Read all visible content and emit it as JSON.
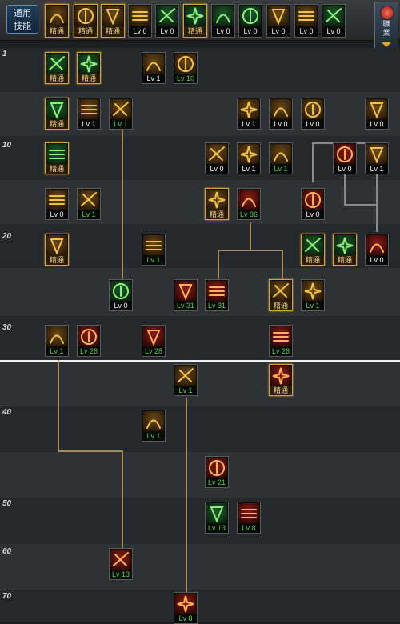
{
  "sidebar": {
    "common_skills_label": [
      "通用",
      "技能"
    ],
    "page_toggle_label": [
      "職",
      "業"
    ]
  },
  "top_skills": [
    {
      "badge": "精通",
      "theme": "gold"
    },
    {
      "badge": "精通",
      "theme": "gold"
    },
    {
      "badge": "精通",
      "theme": "gold"
    },
    {
      "badge": "Lv 0",
      "theme": "gold"
    },
    {
      "badge": "Lv 0",
      "theme": "green"
    },
    {
      "badge": "精通",
      "theme": "green"
    },
    {
      "badge": "Lv 0",
      "theme": "green"
    },
    {
      "badge": "Lv 0",
      "theme": "green"
    },
    {
      "badge": "Lv 0",
      "theme": "gold"
    },
    {
      "badge": "Lv 0",
      "theme": "gold"
    },
    {
      "badge": "Lv 0",
      "theme": "green"
    }
  ],
  "level_labels": [
    "1",
    "10",
    "20",
    "30",
    "40",
    "50",
    "60",
    "70"
  ],
  "skills": [
    {
      "badge": "精通",
      "kind": "master",
      "theme": "green"
    },
    {
      "badge": "精通",
      "kind": "master",
      "theme": "green"
    },
    {
      "badge": "Lv 1",
      "kind": "white",
      "theme": "gold"
    },
    {
      "badge": "Lv 10",
      "kind": "green",
      "theme": "gold"
    },
    {
      "badge": "精通",
      "kind": "master",
      "theme": "green"
    },
    {
      "badge": "Lv 1",
      "kind": "white",
      "theme": "gold"
    },
    {
      "badge": "Lv 1",
      "kind": "green",
      "theme": "gold"
    },
    {
      "badge": "Lv 1",
      "kind": "white",
      "theme": "gold"
    },
    {
      "badge": "Lv 0",
      "kind": "white",
      "theme": "gold"
    },
    {
      "badge": "Lv 0",
      "kind": "white",
      "theme": "gold"
    },
    {
      "badge": "Lv 0",
      "kind": "white",
      "theme": "gold"
    },
    {
      "badge": "精通",
      "kind": "master",
      "theme": "green"
    },
    {
      "badge": "Lv 0",
      "kind": "white",
      "theme": "gold"
    },
    {
      "badge": "Lv 1",
      "kind": "white",
      "theme": "gold"
    },
    {
      "badge": "Lv 1",
      "kind": "green",
      "theme": "gold"
    },
    {
      "badge": "Lv 0",
      "kind": "white",
      "theme": "red"
    },
    {
      "badge": "Lv 1",
      "kind": "white",
      "theme": "gold"
    },
    {
      "badge": "Lv 0",
      "kind": "white",
      "theme": "gold"
    },
    {
      "badge": "Lv 1",
      "kind": "green",
      "theme": "gold"
    },
    {
      "badge": "精通",
      "kind": "master",
      "theme": "gold"
    },
    {
      "badge": "Lv 36",
      "kind": "green",
      "theme": "red"
    },
    {
      "badge": "Lv 0",
      "kind": "white",
      "theme": "red"
    },
    {
      "badge": "精通",
      "kind": "master",
      "theme": "gold"
    },
    {
      "badge": "Lv 1",
      "kind": "green",
      "theme": "gold"
    },
    {
      "badge": "精通",
      "kind": "master",
      "theme": "green"
    },
    {
      "badge": "精通",
      "kind": "master",
      "theme": "green"
    },
    {
      "badge": "Lv 0",
      "kind": "white",
      "theme": "red"
    },
    {
      "badge": "Lv 0",
      "kind": "white",
      "theme": "green"
    },
    {
      "badge": "Lv 31",
      "kind": "green",
      "theme": "red"
    },
    {
      "badge": "Lv 31",
      "kind": "green",
      "theme": "red"
    },
    {
      "badge": "精通",
      "kind": "master",
      "theme": "gold"
    },
    {
      "badge": "Lv 1",
      "kind": "green",
      "theme": "gold"
    },
    {
      "badge": "Lv 1",
      "kind": "green",
      "theme": "gold"
    },
    {
      "badge": "Lv 28",
      "kind": "green",
      "theme": "red"
    },
    {
      "badge": "Lv 28",
      "kind": "green",
      "theme": "red"
    },
    {
      "badge": "Lv 28",
      "kind": "green",
      "theme": "red"
    },
    {
      "badge": "Lv 1",
      "kind": "green",
      "theme": "gold"
    },
    {
      "badge": "精通",
      "kind": "master",
      "theme": "red"
    },
    {
      "badge": "Lv 1",
      "kind": "green",
      "theme": "gold"
    },
    {
      "badge": "Lv 21",
      "kind": "green",
      "theme": "red"
    },
    {
      "badge": "Lv 13",
      "kind": "green",
      "theme": "green"
    },
    {
      "badge": "Lv 8",
      "kind": "green",
      "theme": "red"
    },
    {
      "badge": "Lv 13",
      "kind": "green",
      "theme": "red"
    },
    {
      "badge": "Lv 8",
      "kind": "green",
      "theme": "red"
    }
  ]
}
